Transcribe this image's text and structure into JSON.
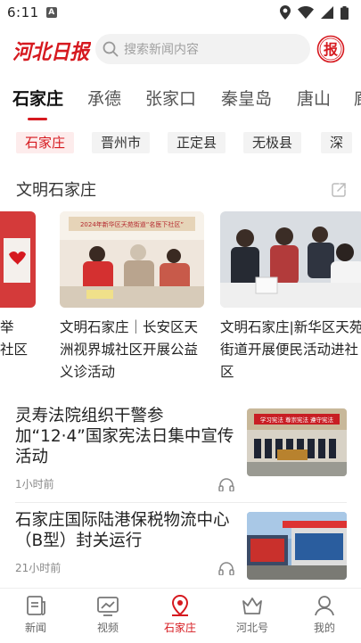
{
  "status_bar": {
    "time": "6:11",
    "badge": "A"
  },
  "header": {
    "logo_text": "河北日报",
    "search_placeholder": "搜索新闻内容",
    "bao_label": "报"
  },
  "tabs": [
    {
      "label": "石家庄",
      "active": true
    },
    {
      "label": "承德",
      "active": false
    },
    {
      "label": "张家口",
      "active": false
    },
    {
      "label": "秦皇岛",
      "active": false
    },
    {
      "label": "唐山",
      "active": false
    },
    {
      "label": "廊",
      "active": false
    }
  ],
  "chips": [
    {
      "label": "石家庄",
      "active": true
    },
    {
      "label": "晋州市",
      "active": false
    },
    {
      "label": "正定县",
      "active": false
    },
    {
      "label": "无极县",
      "active": false
    },
    {
      "label": "深",
      "active": false
    }
  ],
  "section": {
    "title": "文明石家庄",
    "cards": [
      {
        "caption_lines": [
          "举",
          "社区"
        ]
      },
      {
        "caption": "文明石家庄｜长安区天洲视界城社区开展公益义诊活动",
        "banner": "2024年新华区天苑街道“名医下社区”"
      },
      {
        "caption": "文明石家庄|新华区天苑街道开展便民活动进社区"
      }
    ]
  },
  "news": [
    {
      "title": "灵寿法院组织干警参加“12·4”国家宪法日集中宣传活动",
      "time": "1小时前",
      "thumb_banner": "学习宪法 尊崇宪法 遵守宪法"
    },
    {
      "title": "石家庄国际陆港保税物流中心（B型）封关运行",
      "time": "21小时前"
    }
  ],
  "bottom_nav": [
    {
      "label": "新闻",
      "icon": "news-icon",
      "active": false
    },
    {
      "label": "视频",
      "icon": "video-icon",
      "active": false
    },
    {
      "label": "石家庄",
      "icon": "location-icon",
      "active": true
    },
    {
      "label": "河北号",
      "icon": "crown-icon",
      "active": false
    },
    {
      "label": "我的",
      "icon": "profile-icon",
      "active": false
    }
  ],
  "colors": {
    "accent": "#d6191f",
    "text": "#222222",
    "muted": "#888888"
  }
}
